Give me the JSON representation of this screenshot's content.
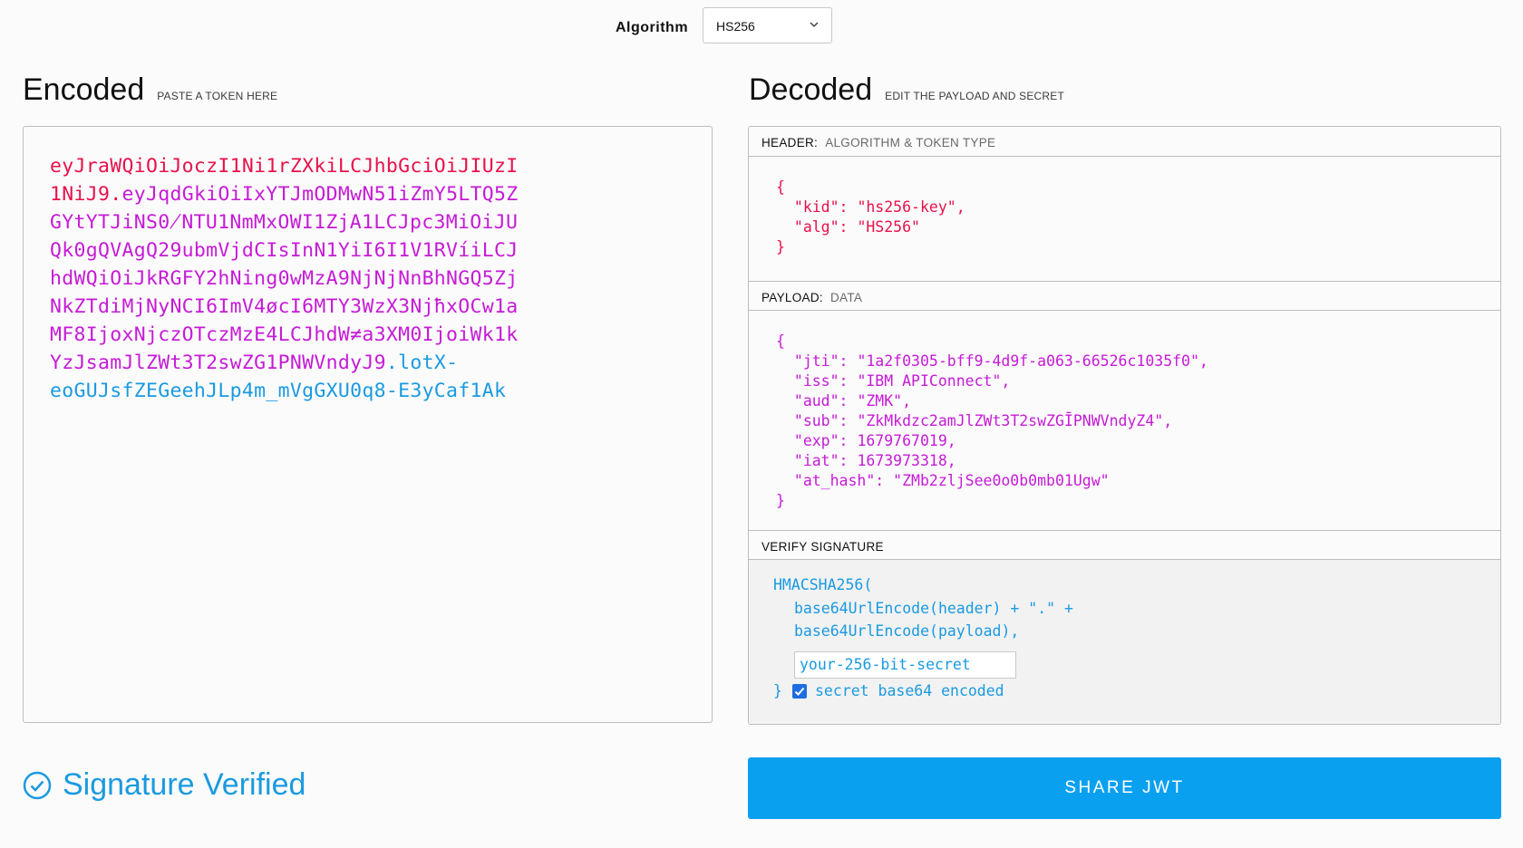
{
  "algorithm": {
    "label": "Algorithm",
    "selected": "HS256"
  },
  "encoded": {
    "title": "Encoded",
    "subtitle": "PASTE A TOKEN HERE",
    "lines": [
      {
        "parts": [
          {
            "t": "eyJraWQiOiJoczI1Ni1rZXkiLCJhbGciOiJIUzI",
            "c": "header"
          }
        ]
      },
      {
        "parts": [
          {
            "t": "1NiJ9",
            "c": "header"
          },
          {
            "t": ".",
            "c": "header"
          },
          {
            "t": "eyJqdGkiOiIxYTJmODMwN51iZmY5LTQ5Z",
            "c": "payload"
          }
        ]
      },
      {
        "parts": [
          {
            "t": "GYtYTJiNS0̸NTU1NmMxOWI1ZjA1LCJpc3MiOiJU",
            "c": "payload"
          }
        ]
      },
      {
        "parts": [
          {
            "t": "Qk0gQVAgQ29ubmVjdCIsInN1YiI6I1V1RVíiLCJ",
            "c": "payload"
          }
        ]
      },
      {
        "parts": [
          {
            "t": "hdWQiOiJkRGFY2hNing0wMzA9NjNjNnBhNGQ5Zj",
            "c": "payload"
          }
        ]
      },
      {
        "parts": [
          {
            "t": "NkZTdiMjNyNCI6ImV4øcI6MTY3WzX3NjħxOCw1a",
            "c": "payload"
          }
        ]
      },
      {
        "parts": [
          {
            "t": "MF8IjoxNjczOTczMzE4LCJhdW≠a3XM0IjoiWk1k",
            "c": "payload"
          }
        ]
      },
      {
        "parts": [
          {
            "t": "YzJsamJlZWt3T2swZG1PNWVndyJ9",
            "c": "payload"
          },
          {
            "t": ".lotX-",
            "c": "sig"
          }
        ]
      },
      {
        "parts": [
          {
            "t": "eoGUJsfZEGeehJLp4m_mVgGXU0q8-E3yCaf1Ak",
            "c": "sig"
          }
        ]
      }
    ]
  },
  "decoded": {
    "title": "Decoded",
    "subtitle": "EDIT THE PAYLOAD AND SECRET",
    "header_section": {
      "label": "HEADER:",
      "sublabel": "ALGORITHM & TOKEN TYPE",
      "fields": [
        {
          "key": "kid",
          "value": "\"hs256-key\","
        },
        {
          "key": "alg",
          "value": "\"HS256\""
        }
      ]
    },
    "payload": {
      "label": "PAYLOAD:",
      "sublabel": "DATA",
      "fields": [
        {
          "key": "jti",
          "value": "\"1a2f0305-bff9-4d9f-a063-66526c1035f0\","
        },
        {
          "key": "iss",
          "value": "\"IBM APIConnect\","
        },
        {
          "key": "aud",
          "value": "\"ZMK\","
        },
        {
          "key": "sub",
          "value": "\"ZkMkdzc2amJlZWt3T2swZGĪPNWVndyZ4\","
        },
        {
          "key": "exp",
          "value": "1679767019,"
        },
        {
          "key": "iat",
          "value": "1673973318,"
        },
        {
          "key": "at_hash",
          "value": "\"ZMb2zljSee0o0b0mb01Ugw\""
        }
      ]
    },
    "verify": {
      "label": "VERIFY SIGNATURE",
      "fn_open": "HMACSHA256(",
      "line1": "base64UrlEncode(header) + \".\" +",
      "line2": "base64UrlEncode(payload),",
      "secret_value": "your-256-bit-secret",
      "close": "}",
      "checkbox_checked": true,
      "checkbox_label": "secret base64 encoded"
    }
  },
  "status": {
    "verified_text": "Signature Verified"
  },
  "share_button": "SHARE JWT",
  "colors": {
    "header": "#e8114a",
    "payload": "#c51bd6",
    "signature": "#1a9ae0",
    "accent": "#0aa0f0"
  }
}
